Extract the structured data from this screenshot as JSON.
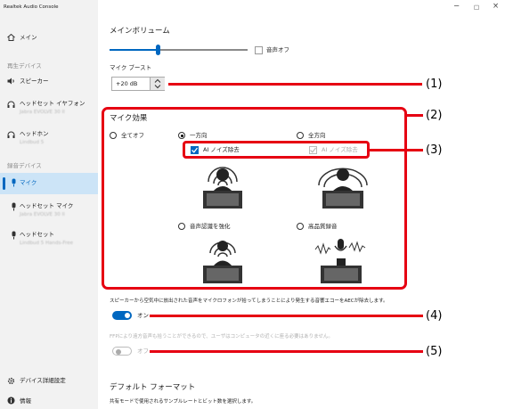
{
  "window": {
    "title": "Realtek Audio Console",
    "controls": [
      "−",
      "□",
      "×"
    ]
  },
  "sidebar": {
    "home": "メイン",
    "playback_header": "再生デバイス",
    "playback": [
      {
        "label": "スピーカー",
        "sub": ""
      },
      {
        "label": "ヘッドセット イヤフォン",
        "sub": "Jabra EVOLVE 30 II"
      },
      {
        "label": "ヘッドホン",
        "sub": "Lindbud 5"
      }
    ],
    "record_header": "録音デバイス",
    "record": [
      {
        "label": "マイク",
        "sub": "",
        "selected": true
      },
      {
        "label": "ヘッドセット マイク",
        "sub": "Jabra EVOLVE 30 II"
      },
      {
        "label": "ヘッドセット",
        "sub": "Lindbud 5 Hands-Free"
      }
    ],
    "advanced": "デバイス詳細設定",
    "info": "情報"
  },
  "main": {
    "volume_title": "メインボリューム",
    "volume_level": 0.35,
    "mute_label": "音声オフ",
    "mute_checked": false,
    "boost_label": "マイク ブースト",
    "boost_value": "+20 dB",
    "effects_title": "マイク効果",
    "options": {
      "all_off": "全てオフ",
      "directional": "一方向",
      "omni": "全方向",
      "speech": "音声認識を強化",
      "hq": "高品質録音"
    },
    "selected_option": "directional",
    "ai_noise": "AI ノイズ除去",
    "ai_noise_omni": "AI ノイズ除去",
    "aec_text": "スピーカーから空気中に放出された音声をマイクロフォンが拾ってしまうことにより発生する音響エコーをAECが除去します。",
    "aec_toggle_label": "オン",
    "aec_on": true,
    "ffp_text": "FFPにより遠方音声も拾うことができるので、ユーザはコンピュータの近くに座る必要はありません。",
    "ffp_toggle_label": "オフ",
    "ffp_on": false,
    "default_format_title": "デフォルト フォーマット",
    "default_format_desc": "共有モードで使用されるサンプルレートとビット数を選択します。"
  },
  "callouts": [
    "(1)",
    "(2)",
    "(3)",
    "(4)",
    "(5)"
  ],
  "colors": {
    "accent": "#0067c0",
    "callout_red": "#e60012",
    "sidebar_bg": "#f2f2f2",
    "selected_bg": "#cce4f7"
  }
}
